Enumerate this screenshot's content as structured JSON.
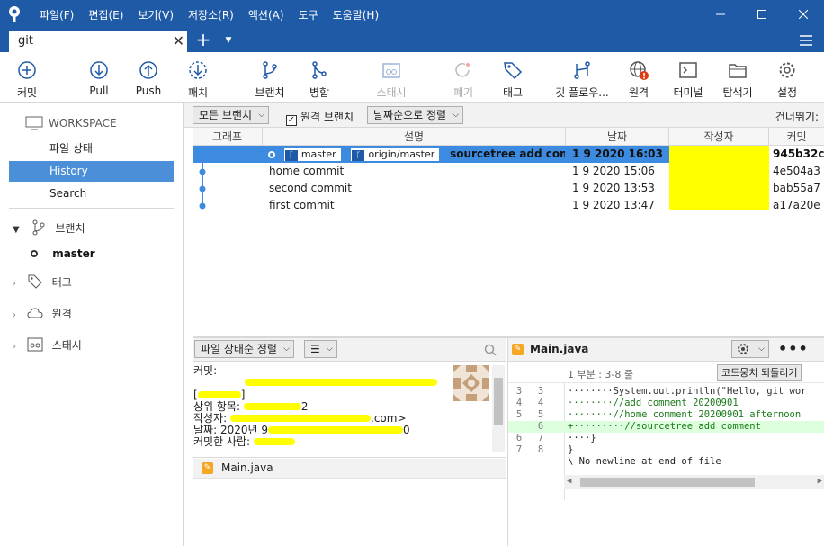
{
  "menu": [
    "파일(F)",
    "편집(E)",
    "보기(V)",
    "저장소(R)",
    "액션(A)",
    "도구",
    "도움말(H)"
  ],
  "tab": {
    "label": "git"
  },
  "toolbar": {
    "commit": "커밋",
    "pull": "Pull",
    "push": "Push",
    "fetch": "패치",
    "branch": "브랜치",
    "merge": "병합",
    "stash": "스태시",
    "discard": "폐기",
    "tag": "태그",
    "gitflow": "깃 플로우...",
    "remote": "원격",
    "terminal": "터미널",
    "explorer": "탐색기",
    "settings": "설정"
  },
  "sidebar": {
    "workspace": "WORKSPACE",
    "file_status": "파일 상태",
    "history": "History",
    "search": "Search",
    "branches": "브랜치",
    "branch_master": "master",
    "tags": "태그",
    "remotes": "원격",
    "stashes": "스태시"
  },
  "history": {
    "filter_branches": "모든 브랜치",
    "remote_branches": "원격 브랜치",
    "remote_branches_checked": true,
    "sort": "날짜순으로 정렬",
    "skip": "건너뛰기:",
    "columns": {
      "graph": "그래프",
      "description": "설명",
      "date": "날짜",
      "author": "작성자",
      "commit": "커밋"
    },
    "commits": [
      {
        "description": "sourcetree add comment",
        "date": "1 9 2020 16:03",
        "hash": "945b32c",
        "branch": "master",
        "remote": "origin/master"
      },
      {
        "description": "home commit",
        "date": "1 9 2020 15:06",
        "hash": "4e504a3"
      },
      {
        "description": "second commit",
        "date": "1 9 2020 13:53",
        "hash": "bab55a7"
      },
      {
        "description": "first commit",
        "date": "1 9 2020 13:47",
        "hash": "a17a20e"
      }
    ]
  },
  "files_pane": {
    "sort": "파일 상태순 정렬",
    "view": "☰",
    "commit_label": "커밋:",
    "parent_label": "상위 항목:",
    "author_label": "작성자:",
    "author_suffix": ".com>",
    "date_label": "날짜: 2020년 9",
    "date_suffix": "0",
    "committer_label": "커밋한 사람:",
    "bracket_open": "[",
    "bracket_close": "]",
    "parent_suffix": "2",
    "files": [
      "Main.java"
    ]
  },
  "diff": {
    "filename": "Main.java",
    "hunk": "1 부분 : 3-8 줄",
    "revert_hunk": "코드뭉치 되돌리기",
    "lines": [
      {
        "o": "3",
        "n": "3",
        "text": "········System.out.println(\"Hello, git wor",
        "added": false
      },
      {
        "o": "4",
        "n": "4",
        "text": "········//add comment 20200901",
        "added": false
      },
      {
        "o": "5",
        "n": "5",
        "text": "········//home comment 20200901 afternoon",
        "added": false
      },
      {
        "o": "",
        "n": "6",
        "text": "+·········//sourcetree add comment",
        "added": true
      },
      {
        "o": "6",
        "n": "7",
        "text": "····}",
        "added": false
      },
      {
        "o": "7",
        "n": "8",
        "text": "}",
        "added": false
      },
      {
        "o": "",
        "n": "",
        "text": "\\ No newline at end of file",
        "added": false
      }
    ]
  },
  "colors": {
    "accent": "#1f5aa6",
    "selection": "#3c8be0",
    "sidebar_active": "#4a8fd8",
    "redaction": "#ffff00"
  }
}
